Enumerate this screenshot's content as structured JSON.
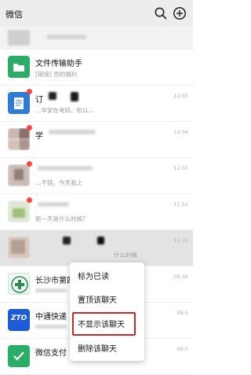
{
  "header": {
    "title": "微信"
  },
  "chats": [
    {
      "name": "文件传输助手",
      "preview": "[链接] 员的福利",
      "time": ""
    },
    {
      "name": "订",
      "preview": "…华安在考研。所以…",
      "time": "12:05"
    },
    {
      "name": "学",
      "preview": "",
      "time": "12:04"
    },
    {
      "name": "",
      "preview": "…不错。今天我上",
      "time": "12:03"
    },
    {
      "name": "",
      "preview": "新一天是什么时候？",
      "time": "11:52"
    },
    {
      "name": "",
      "preview": "什么时候",
      "time": "11:52"
    },
    {
      "name": "长沙市第四",
      "preview": "",
      "time": "09:36"
    },
    {
      "name": "中通快递",
      "preview": "",
      "time": "08:5"
    },
    {
      "name": "微信支付",
      "preview": "",
      "time": "08:5"
    }
  ],
  "context_menu": {
    "items": [
      "标为已读",
      "置顶该聊天",
      "不显示该聊天",
      "删除该聊天"
    ]
  },
  "avatars": {
    "file_transfer_color": "#2aae67",
    "ztо_label": "ZTO"
  }
}
